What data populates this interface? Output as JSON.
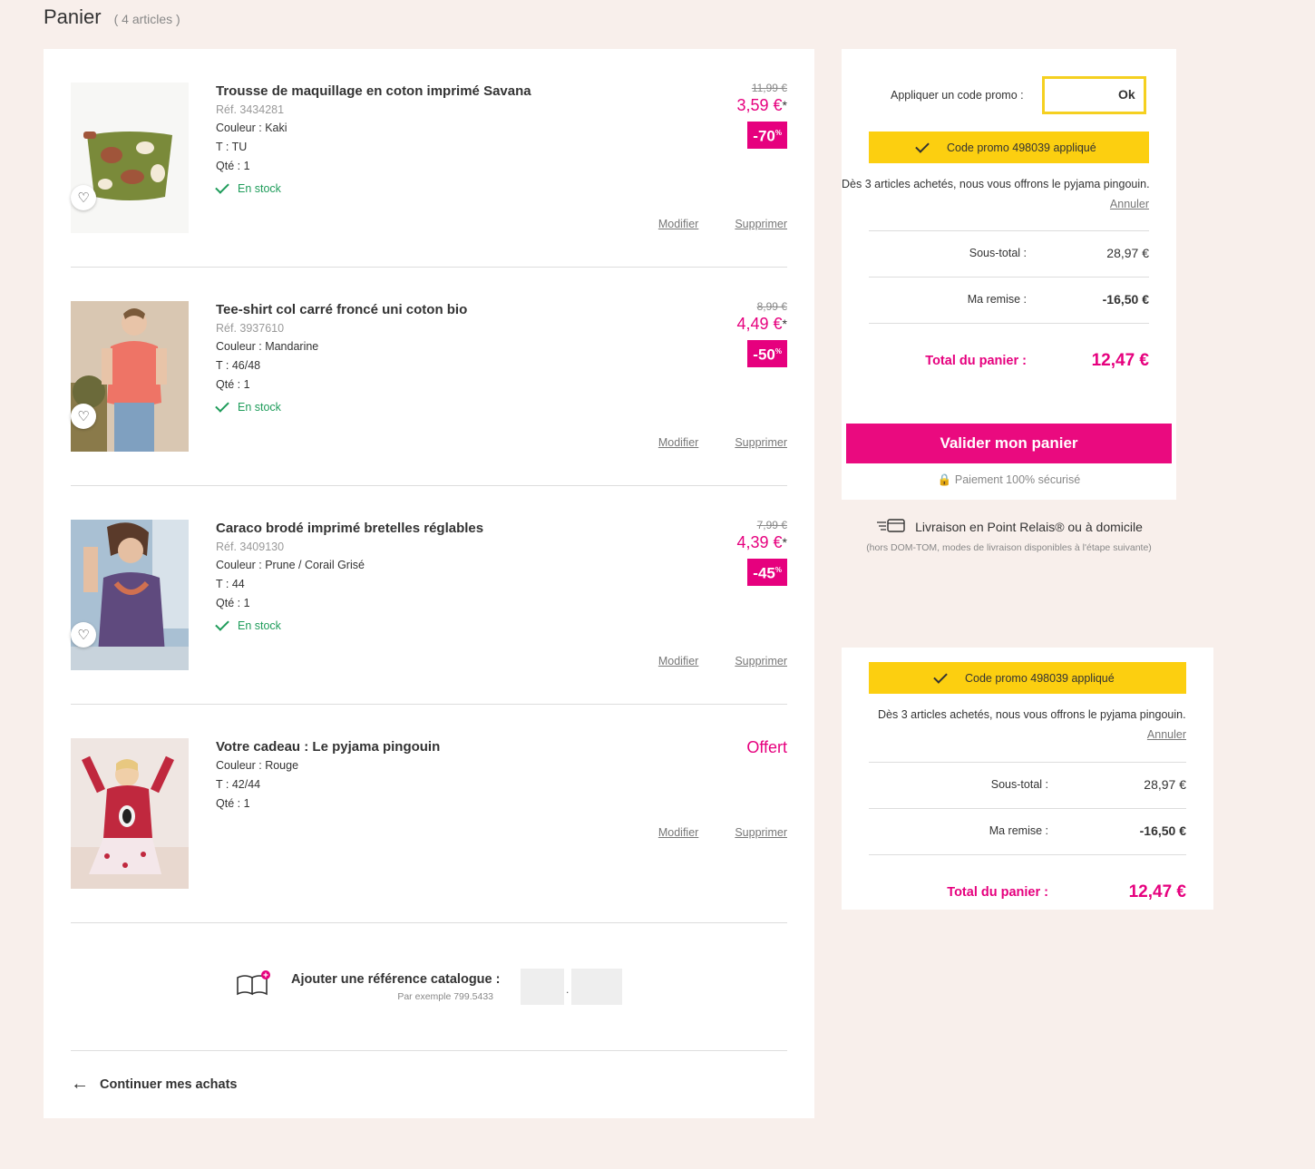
{
  "header": {
    "title": "Panier",
    "count": "( 4 articles )"
  },
  "items": [
    {
      "name": "Trousse de maquillage en coton imprimé Savana",
      "ref": "Réf. 3434281",
      "color": "Couleur : Kaki",
      "size": "T : TU",
      "qty": "Qté : 1",
      "stock": "En stock",
      "old_price": "11,99 €",
      "new_price": "3,59 €",
      "price_mark": "*",
      "discount": "-70",
      "discount_unit": "%"
    },
    {
      "name": "Tee-shirt col carré froncé uni coton bio",
      "ref": "Réf. 3937610",
      "color": "Couleur : Mandarine",
      "size": "T : 46/48",
      "qty": "Qté : 1",
      "stock": "En stock",
      "old_price": "8,99 €",
      "new_price": "4,49 €",
      "price_mark": "*",
      "discount": "-50",
      "discount_unit": "%"
    },
    {
      "name": "Caraco brodé imprimé bretelles réglables",
      "ref": "Réf. 3409130",
      "color": "Couleur : Prune / Corail Grisé",
      "size": "T : 44",
      "qty": "Qté : 1",
      "stock": "En stock",
      "old_price": "7,99 €",
      "new_price": "4,39 €",
      "price_mark": "*",
      "discount": "-45",
      "discount_unit": "%"
    },
    {
      "name": "Votre cadeau : Le pyjama pingouin",
      "color": "Couleur : Rouge",
      "size": "T : 42/44",
      "qty": "Qté : 1",
      "offered": "Offert"
    }
  ],
  "actions": {
    "modify": "Modifier",
    "delete": "Supprimer"
  },
  "catalog": {
    "label": "Ajouter une référence catalogue :",
    "hint": "Par exemple 799.5433",
    "separator": "."
  },
  "continue_label": "Continuer mes achats",
  "summary": {
    "promo_label": "Appliquer un code promo :",
    "promo_ok": "Ok",
    "promo_applied": "Code promo 498039 appliqué",
    "offer_text": "Dès 3 articles achetés, nous vous offrons le pyjama pingouin.",
    "cancel": "Annuler",
    "subtotal_label": "Sous-total :",
    "subtotal_value": "28,97 €",
    "discount_label": "Ma remise :",
    "discount_value": "-16,50 €",
    "total_label": "Total du panier :",
    "total_value": "12,47 €",
    "validate": "Valider mon panier",
    "secure": "Paiement 100% sécurisé"
  },
  "delivery": {
    "line": "Livraison en Point Relais® ou à domicile",
    "sub": "(hors DOM-TOM, modes de livraison disponibles à l'étape suivante)"
  },
  "colors": {
    "accent": "#e6007e",
    "promo": "#fccf10",
    "stock": "#1e9c5a"
  }
}
